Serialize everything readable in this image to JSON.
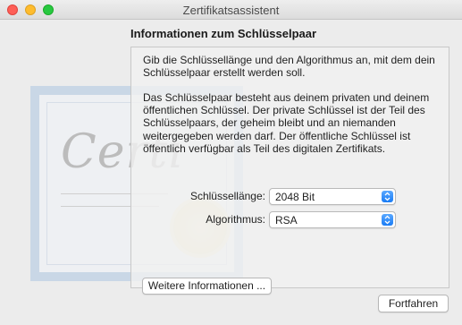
{
  "window": {
    "title": "Zertifikatsassistent"
  },
  "section": {
    "title": "Informationen zum Schlüsselpaar"
  },
  "panel": {
    "intro": "Gib die Schlüssellänge und den Algorithmus an, mit dem dein Schlüsselpaar erstellt werden soll.",
    "description": "Das Schlüsselpaar besteht aus deinem privaten und deinem öffentlichen Schlüssel. Der private Schlüssel ist der Teil des Schlüsselpaars, der geheim bleibt und an niemanden weitergegeben werden darf. Der öffentliche Schlüssel ist öffentlich verfügbar als Teil des digitalen Zertifikats.",
    "key_length": {
      "label": "Schlüssellänge:",
      "value": "2048 Bit"
    },
    "algorithm": {
      "label": "Algorithmus:",
      "value": "RSA"
    },
    "more_info_label": "Weitere Informationen ..."
  },
  "footer": {
    "continue_label": "Fortfahren"
  },
  "watermark": {
    "text": "Certi"
  },
  "colors": {
    "accent": "#1a7cf5",
    "close": "#fe5f57",
    "minimize": "#febc2e",
    "maximize": "#28c840"
  }
}
